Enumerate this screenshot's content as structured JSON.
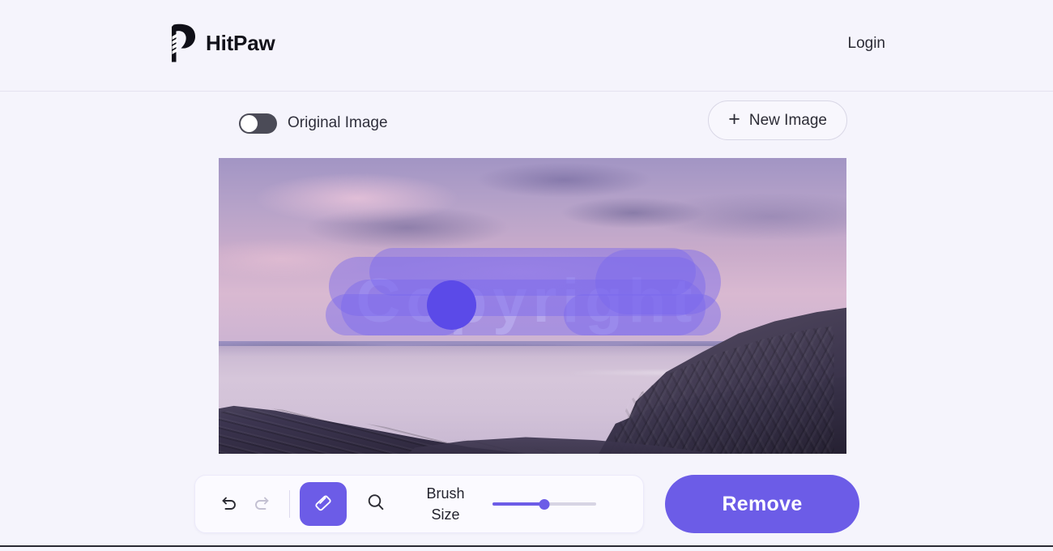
{
  "header": {
    "brand_name": "HitPaw",
    "logo_icon": "hitpaw-paw-p-logo",
    "login_label": "Login"
  },
  "controls": {
    "original_toggle": {
      "label": "Original Image",
      "state": "off"
    },
    "new_image_button": {
      "label": "New Image",
      "icon": "plus-icon"
    }
  },
  "canvas": {
    "watermark_text": "Copyright",
    "mask_color": "#7b68ee",
    "brush_cursor_color": "#5b4ae8",
    "scene": "coastal sunset seascape with purple sky, misty water and dark rocks"
  },
  "toolbar": {
    "undo": {
      "icon": "undo-icon",
      "state": "enabled"
    },
    "redo": {
      "icon": "redo-icon",
      "state": "disabled"
    },
    "eraser": {
      "icon": "eraser-icon",
      "state": "active"
    },
    "zoom": {
      "icon": "magnifier-icon",
      "state": "inactive"
    },
    "brush_size": {
      "label_line1": "Brush",
      "label_line2": "Size",
      "value": 50,
      "min": 0,
      "max": 100
    }
  },
  "actions": {
    "remove_label": "Remove"
  },
  "colors": {
    "accent": "#6c5ce7",
    "background": "#f5f4fc",
    "toggle_off": "#4b4b57"
  }
}
